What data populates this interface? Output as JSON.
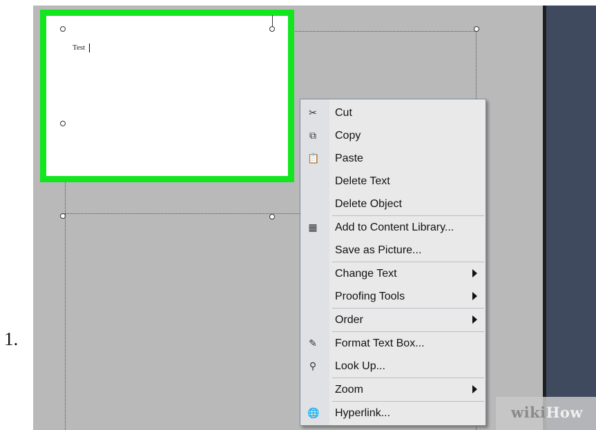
{
  "step_number": "1.",
  "text_box": {
    "content": "Test"
  },
  "context_menu": {
    "items": [
      {
        "label": "Cut",
        "icon": "scissors-icon",
        "glyph": "✂",
        "submenu": false
      },
      {
        "label": "Copy",
        "icon": "copy-icon",
        "glyph": "⧉",
        "submenu": false
      },
      {
        "label": "Paste",
        "icon": "paste-icon",
        "glyph": "📋",
        "submenu": false
      },
      {
        "label": "Delete Text",
        "icon": "",
        "glyph": "",
        "submenu": false
      },
      {
        "label": "Delete Object",
        "icon": "",
        "glyph": "",
        "submenu": false
      },
      {
        "label": "Add to Content Library...",
        "icon": "content-library-icon",
        "glyph": "▦",
        "submenu": false
      },
      {
        "label": "Save as Picture...",
        "icon": "",
        "glyph": "",
        "submenu": false
      },
      {
        "label": "Change Text",
        "icon": "",
        "glyph": "",
        "submenu": true
      },
      {
        "label": "Proofing Tools",
        "icon": "",
        "glyph": "",
        "submenu": true
      },
      {
        "label": "Order",
        "icon": "",
        "glyph": "",
        "submenu": true
      },
      {
        "label": "Format Text Box...",
        "icon": "format-text-box-icon",
        "glyph": "✎",
        "submenu": false
      },
      {
        "label": "Look Up...",
        "icon": "binoculars-icon",
        "glyph": "⚲",
        "submenu": false
      },
      {
        "label": "Zoom",
        "icon": "",
        "glyph": "",
        "submenu": true
      },
      {
        "label": "Hyperlink...",
        "icon": "globe-link-icon",
        "glyph": "🌐",
        "submenu": false
      }
    ]
  },
  "watermark": {
    "wiki": "wiki",
    "how": "How"
  },
  "colors": {
    "selection_highlight": "#11e61e",
    "canvas": "#b9b9b9",
    "side_panel": "#404a5e",
    "menu_background": "#e9e9ea"
  }
}
